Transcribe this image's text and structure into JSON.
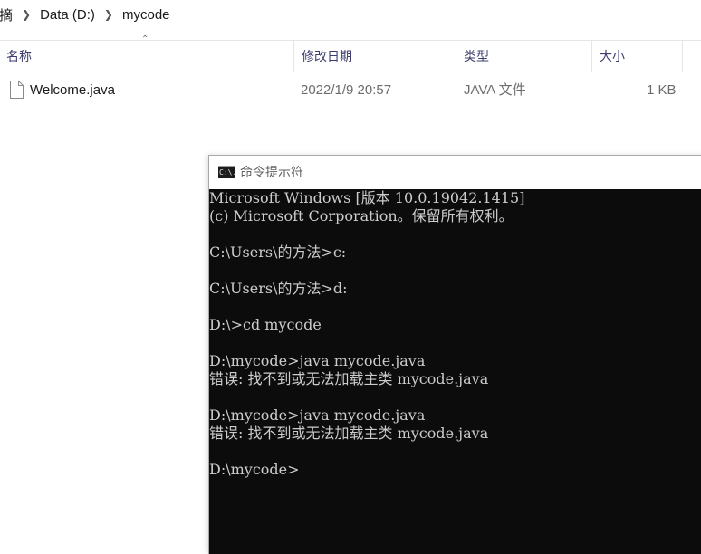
{
  "breadcrumb": {
    "items": [
      "摘",
      "Data (D:)",
      "mycode"
    ]
  },
  "columns": {
    "name": "名称",
    "modified": "修改日期",
    "type": "类型",
    "size": "大小"
  },
  "files": [
    {
      "name": "Welcome.java",
      "modified": "2022/1/9 20:57",
      "type": "JAVA 文件",
      "size": "1 KB"
    }
  ],
  "cmd": {
    "title": "命令提示符",
    "icon_text": "C:\\.",
    "lines": [
      "Microsoft Windows [版本 10.0.19042.1415]",
      "(c) Microsoft Corporation。保留所有权利。",
      "",
      "C:\\Users\\的方法>c:",
      "",
      "C:\\Users\\的方法>d:",
      "",
      "D:\\>cd mycode",
      "",
      "D:\\mycode>java mycode.java",
      "错误: 找不到或无法加载主类 mycode.java",
      "",
      "D:\\mycode>java mycode.java",
      "错误: 找不到或无法加载主类 mycode.java",
      "",
      "D:\\mycode>"
    ]
  },
  "colors": {
    "console_bg": "#0c0c0c",
    "console_text": "#cccccc",
    "header_text": "#3c3c6e"
  }
}
